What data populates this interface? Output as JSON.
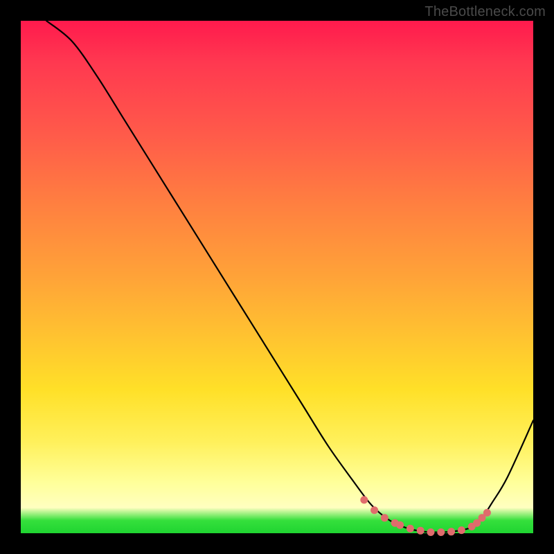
{
  "watermark": "TheBottleneck.com",
  "colors": {
    "background": "#000000",
    "curve": "#000000",
    "marker": "#e06c6c",
    "gradient_top": "#ff1a4d",
    "gradient_bottom": "#1fd431"
  },
  "chart_data": {
    "type": "line",
    "title": "",
    "xlabel": "",
    "ylabel": "",
    "xlim": [
      0,
      100
    ],
    "ylim": [
      0,
      100
    ],
    "series": [
      {
        "name": "bottleneck-curve",
        "x": [
          5,
          10,
          15,
          20,
          25,
          30,
          35,
          40,
          45,
          50,
          55,
          60,
          65,
          68,
          70,
          72,
          74,
          76,
          78,
          80,
          82,
          84,
          86,
          88,
          90,
          92,
          95,
          100
        ],
        "y": [
          100,
          96,
          89,
          81,
          73,
          65,
          57,
          49,
          41,
          33,
          25,
          17,
          10,
          6,
          4,
          2.5,
          1.5,
          0.8,
          0.4,
          0.2,
          0.2,
          0.3,
          0.6,
          1.2,
          3,
          6,
          11,
          22
        ]
      }
    ],
    "markers": {
      "name": "optimal-range",
      "x": [
        67,
        69,
        71,
        73,
        74,
        76,
        78,
        80,
        82,
        84,
        86,
        88,
        89,
        90,
        91
      ],
      "y": [
        6.5,
        4.5,
        3,
        2,
        1.6,
        0.9,
        0.5,
        0.2,
        0.2,
        0.3,
        0.6,
        1.3,
        2,
        3,
        4
      ]
    }
  }
}
